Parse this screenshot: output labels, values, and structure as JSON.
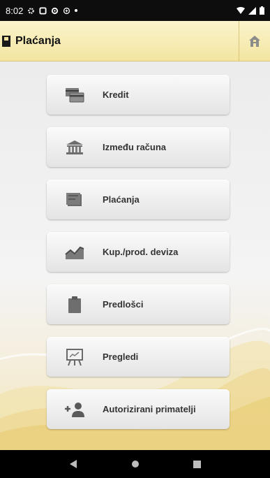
{
  "status_bar": {
    "time": "8:02"
  },
  "app_bar": {
    "title": "Plaćanja"
  },
  "menu": [
    {
      "label": "Kredit",
      "icon": "credit-cards-icon"
    },
    {
      "label": "Između računa",
      "icon": "bank-icon"
    },
    {
      "label": "Plaćanja",
      "icon": "payment-icon"
    },
    {
      "label": "Kup./prod. deviza",
      "icon": "chart-icon"
    },
    {
      "label": "Predlošci",
      "icon": "clipboard-icon"
    },
    {
      "label": "Pregledi",
      "icon": "presentation-board-icon"
    },
    {
      "label": "Autorizirani primatelji",
      "icon": "add-person-icon"
    }
  ]
}
